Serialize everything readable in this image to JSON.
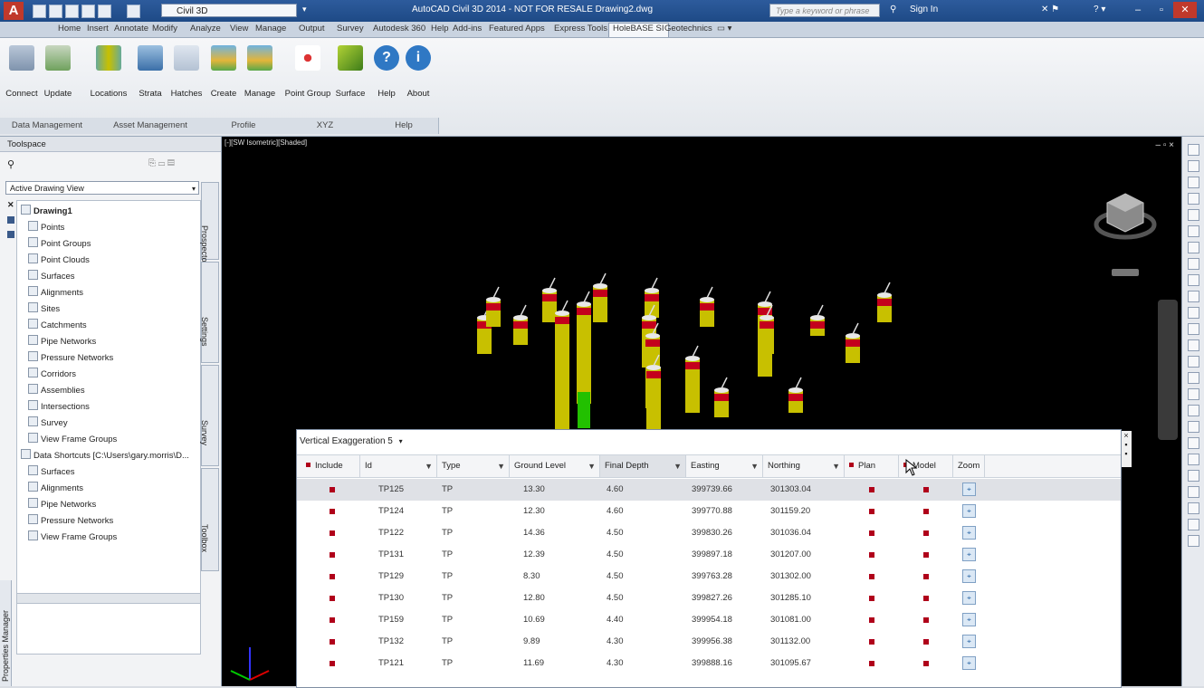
{
  "app": {
    "logo": "A",
    "workspace": "Civil 3D",
    "title": "AutoCAD Civil 3D 2014 - NOT FOR RESALE   Drawing2.dwg",
    "search_placeholder": "Type a keyword or phrase",
    "signin": "Sign In"
  },
  "ribbon_tabs": [
    "Home",
    "Insert",
    "Annotate",
    "Modify",
    "Analyze",
    "View",
    "Manage",
    "Output",
    "Survey",
    "Autodesk 360",
    "Help",
    "Add-ins",
    "Featured Apps",
    "Express Tools",
    "HoleBASE SI",
    "Geotechnics"
  ],
  "active_tab": "HoleBASE SI",
  "ribbon_buttons": [
    {
      "label": "Connect",
      "icon": "database-connect-icon"
    },
    {
      "label": "Update",
      "icon": "database-update-icon"
    },
    {
      "label": "Locations",
      "icon": "locations-icon"
    },
    {
      "label": "Strata",
      "icon": "strata-icon"
    },
    {
      "label": "Hatches",
      "icon": "hatches-icon"
    },
    {
      "label": "Create",
      "icon": "profile-create-icon"
    },
    {
      "label": "Manage",
      "icon": "profile-manage-icon"
    },
    {
      "label": "Point Group",
      "icon": "point-group-icon"
    },
    {
      "label": "Surface",
      "icon": "surface-icon"
    },
    {
      "label": "Help",
      "icon": "help-icon"
    },
    {
      "label": "About",
      "icon": "about-icon"
    }
  ],
  "ribbon_panels": [
    "Data Management",
    "Asset Management",
    "Profile",
    "XYZ",
    "Help"
  ],
  "toolspace": {
    "title": "Toolspace",
    "view_combo": "Active Drawing View",
    "tree": [
      {
        "label": "Drawing1",
        "level": 0
      },
      {
        "label": "Points",
        "level": 1
      },
      {
        "label": "Point Groups",
        "level": 1
      },
      {
        "label": "Point Clouds",
        "level": 1
      },
      {
        "label": "Surfaces",
        "level": 1
      },
      {
        "label": "Alignments",
        "level": 1
      },
      {
        "label": "Sites",
        "level": 1
      },
      {
        "label": "Catchments",
        "level": 1
      },
      {
        "label": "Pipe Networks",
        "level": 1
      },
      {
        "label": "Pressure Networks",
        "level": 1
      },
      {
        "label": "Corridors",
        "level": 1
      },
      {
        "label": "Assemblies",
        "level": 1
      },
      {
        "label": "Intersections",
        "level": 1
      },
      {
        "label": "Survey",
        "level": 1
      },
      {
        "label": "View Frame Groups",
        "level": 1
      },
      {
        "label": "Data Shortcuts [C:\\Users\\gary.morris\\D...",
        "level": 0
      },
      {
        "label": "Surfaces",
        "level": 1
      },
      {
        "label": "Alignments",
        "level": 1
      },
      {
        "label": "Pipe Networks",
        "level": 1
      },
      {
        "label": "Pressure Networks",
        "level": 1
      },
      {
        "label": "View Frame Groups",
        "level": 1
      }
    ],
    "side_tabs": [
      "Prospector",
      "Settings",
      "Survey",
      "Toolbox"
    ],
    "properties_manager": "Properties Manager"
  },
  "viewport": {
    "label": "[-][SW Isometric][Shaded]",
    "controls": "– ▫ ×"
  },
  "holebase": {
    "vertical_exaggeration_label": "Vertical Exaggeration",
    "vertical_exaggeration_value": "5",
    "columns": [
      "Include",
      "Id",
      "Type",
      "Ground Level",
      "Final Depth",
      "Easting",
      "Northing",
      "Plan",
      "Model",
      "Zoom"
    ],
    "rows": [
      {
        "id": "TP125",
        "type": "TP",
        "ground": "13.30",
        "depth": "4.60",
        "easting": "399739.66",
        "northing": "301303.04"
      },
      {
        "id": "TP124",
        "type": "TP",
        "ground": "12.30",
        "depth": "4.60",
        "easting": "399770.88",
        "northing": "301159.20"
      },
      {
        "id": "TP122",
        "type": "TP",
        "ground": "14.36",
        "depth": "4.50",
        "easting": "399830.26",
        "northing": "301036.04"
      },
      {
        "id": "TP131",
        "type": "TP",
        "ground": "12.39",
        "depth": "4.50",
        "easting": "399897.18",
        "northing": "301207.00"
      },
      {
        "id": "TP129",
        "type": "TP",
        "ground": "8.30",
        "depth": "4.50",
        "easting": "399763.28",
        "northing": "301302.00"
      },
      {
        "id": "TP130",
        "type": "TP",
        "ground": "12.80",
        "depth": "4.50",
        "easting": "399827.26",
        "northing": "301285.10"
      },
      {
        "id": "TP159",
        "type": "TP",
        "ground": "10.69",
        "depth": "4.40",
        "easting": "399954.18",
        "northing": "301081.00"
      },
      {
        "id": "TP132",
        "type": "TP",
        "ground": "9.89",
        "depth": "4.30",
        "easting": "399956.38",
        "northing": "301132.00"
      },
      {
        "id": "TP121",
        "type": "TP",
        "ground": "11.69",
        "depth": "4.30",
        "easting": "399888.16",
        "northing": "301095.67"
      }
    ]
  },
  "colors": {
    "include_marker": "#b0001a",
    "borehole_yellow": "#c8c000",
    "borehole_red": "#c4001c",
    "borehole_white": "#e8e8e8",
    "borehole_green": "#22c000"
  }
}
